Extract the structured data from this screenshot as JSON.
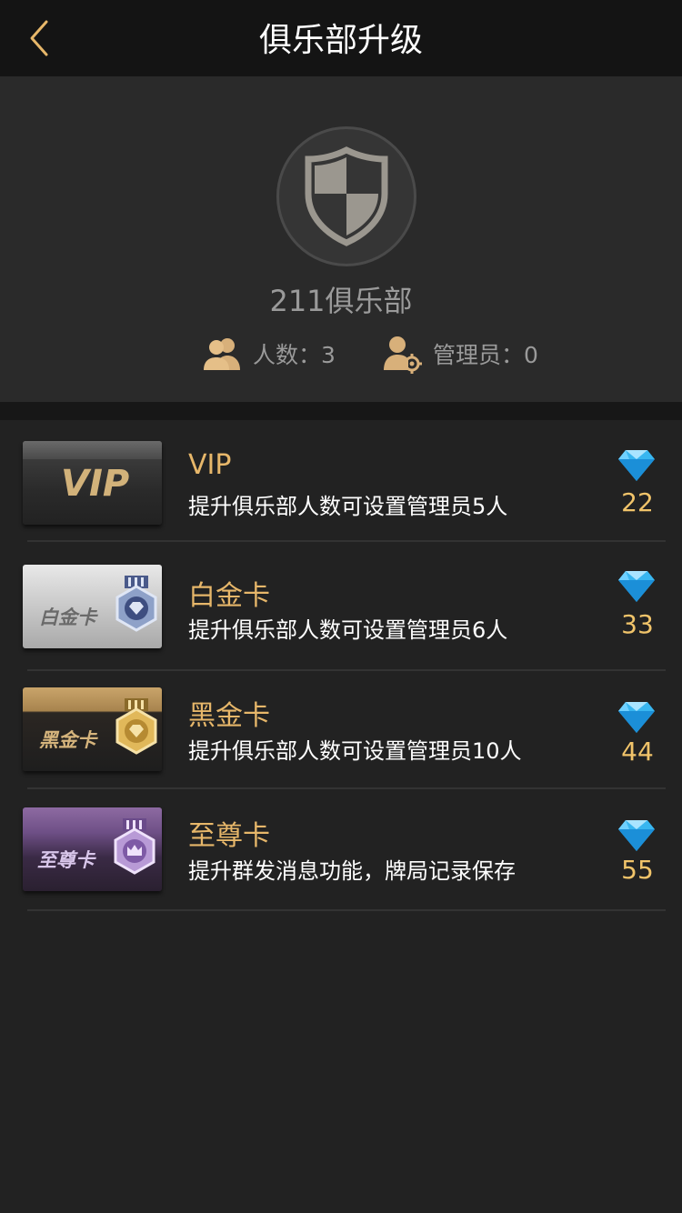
{
  "nav": {
    "title": "俱乐部升级"
  },
  "club": {
    "name": "211俱乐部",
    "members_text": "人数：3",
    "admins_text": "管理员：0"
  },
  "items": [
    {
      "card_label": "VIP",
      "title": "VIP",
      "desc": "提升俱乐部人数可设置管理员5人",
      "price": "22"
    },
    {
      "card_label": "白金卡",
      "title": "白金卡",
      "desc": "提升俱乐部人数可设置管理员6人",
      "price": "33"
    },
    {
      "card_label": "黑金卡",
      "title": "黑金卡",
      "desc": "提升俱乐部人数可设置管理员10人",
      "price": "44"
    },
    {
      "card_label": "至尊卡",
      "title": "至尊卡",
      "desc": "提升群发消息功能，牌局记录保存",
      "price": "55"
    }
  ],
  "icons": {
    "back": "chevron-left-icon",
    "club": "shield-icon",
    "members": "users-icon",
    "admins": "user-gear-icon",
    "price": "diamond-icon"
  },
  "colors": {
    "accent_gold": "#e7b76a",
    "price_gold": "#f1c46a",
    "background": "#222222",
    "navbar": "#141414"
  }
}
